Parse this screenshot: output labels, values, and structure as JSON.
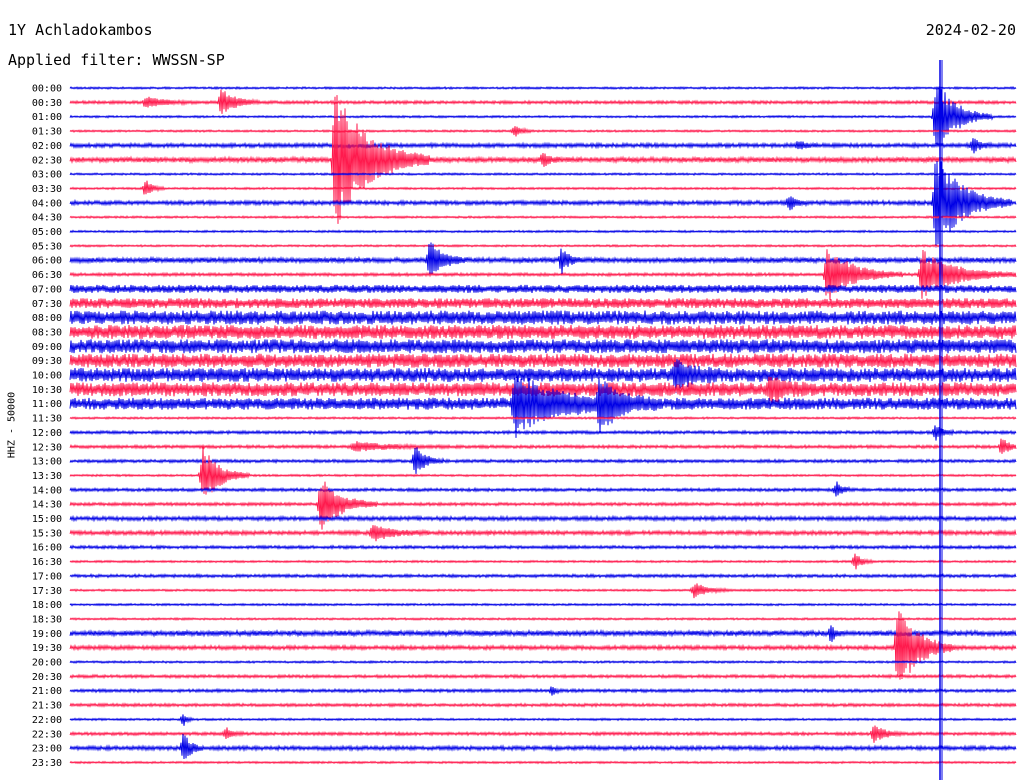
{
  "header": {
    "station": "1Y Achladokambos",
    "date": "2024-02-20",
    "filter": "Applied filter: WWSSN-SP"
  },
  "chart_data": {
    "type": "line",
    "title": "1Y Achladokambos",
    "subtitle": "Applied filter: WWSSN-SP",
    "ylabel": "HHZ - 50000",
    "grid": false,
    "colors": [
      "#0000e6",
      "#ff1a4d"
    ],
    "row_labels": [
      "00:00",
      "00:30",
      "01:00",
      "01:30",
      "02:00",
      "02:30",
      "03:00",
      "03:30",
      "04:00",
      "04:30",
      "05:00",
      "05:30",
      "06:00",
      "06:30",
      "07:00",
      "07:30",
      "08:00",
      "08:30",
      "09:00",
      "09:30",
      "10:00",
      "10:30",
      "11:00",
      "11:30",
      "12:00",
      "12:30",
      "13:00",
      "13:30",
      "14:00",
      "14:30",
      "15:00",
      "15:30",
      "16:00",
      "16:30",
      "17:00",
      "17:30",
      "18:00",
      "18:30",
      "19:00",
      "19:30",
      "20:00",
      "20:30",
      "21:00",
      "21:30",
      "22:00",
      "22:30",
      "23:00",
      "23:30"
    ],
    "noise_level": [
      1,
      1.5,
      1,
      1,
      2,
      2.5,
      1,
      1,
      2,
      1,
      1,
      1,
      2.5,
      1.5,
      4,
      5,
      7,
      7,
      7,
      7,
      7,
      7,
      6,
      1,
      1.5,
      1.5,
      1.5,
      1,
      1.5,
      1.5,
      2,
      2,
      1.5,
      1,
      1.5,
      1,
      1,
      1,
      2.5,
      2,
      1,
      1.5,
      1.5,
      1.5,
      1,
      1.5,
      2,
      1
    ],
    "events": [
      {
        "row": 1,
        "x": 0.08,
        "amp": 6,
        "dur": 0.05
      },
      {
        "row": 1,
        "x": 0.16,
        "amp": 14,
        "dur": 0.04
      },
      {
        "row": 2,
        "x": 0.915,
        "amp": 40,
        "dur": 0.06
      },
      {
        "row": 3,
        "x": 0.47,
        "amp": 6,
        "dur": 0.02
      },
      {
        "row": 4,
        "x": 0.77,
        "amp": 5,
        "dur": 0.02
      },
      {
        "row": 4,
        "x": 0.955,
        "amp": 8,
        "dur": 0.02
      },
      {
        "row": 5,
        "x": 0.28,
        "amp": 70,
        "dur": 0.1
      },
      {
        "row": 5,
        "x": 0.5,
        "amp": 8,
        "dur": 0.02
      },
      {
        "row": 7,
        "x": 0.08,
        "amp": 10,
        "dur": 0.02
      },
      {
        "row": 8,
        "x": 0.76,
        "amp": 8,
        "dur": 0.02
      },
      {
        "row": 8,
        "x": 0.915,
        "amp": 50,
        "dur": 0.08
      },
      {
        "row": 12,
        "x": 0.38,
        "amp": 20,
        "dur": 0.04
      },
      {
        "row": 12,
        "x": 0.52,
        "amp": 14,
        "dur": 0.02
      },
      {
        "row": 13,
        "x": 0.9,
        "amp": 25,
        "dur": 0.1
      },
      {
        "row": 13,
        "x": 0.8,
        "amp": 28,
        "dur": 0.08
      },
      {
        "row": 20,
        "x": 0.64,
        "amp": 14,
        "dur": 0.05
      },
      {
        "row": 21,
        "x": 0.74,
        "amp": 12,
        "dur": 0.04
      },
      {
        "row": 22,
        "x": 0.47,
        "amp": 30,
        "dur": 0.12
      },
      {
        "row": 22,
        "x": 0.56,
        "amp": 26,
        "dur": 0.06
      },
      {
        "row": 24,
        "x": 0.915,
        "amp": 9,
        "dur": 0.02
      },
      {
        "row": 25,
        "x": 0.3,
        "amp": 5,
        "dur": 0.1
      },
      {
        "row": 25,
        "x": 0.985,
        "amp": 11,
        "dur": 0.02
      },
      {
        "row": 26,
        "x": 0.365,
        "amp": 16,
        "dur": 0.03
      },
      {
        "row": 27,
        "x": 0.14,
        "amp": 30,
        "dur": 0.05
      },
      {
        "row": 28,
        "x": 0.81,
        "amp": 8,
        "dur": 0.02
      },
      {
        "row": 29,
        "x": 0.265,
        "amp": 28,
        "dur": 0.06
      },
      {
        "row": 31,
        "x": 0.32,
        "amp": 8,
        "dur": 0.06
      },
      {
        "row": 33,
        "x": 0.83,
        "amp": 9,
        "dur": 0.02
      },
      {
        "row": 35,
        "x": 0.66,
        "amp": 8,
        "dur": 0.04
      },
      {
        "row": 38,
        "x": 0.805,
        "amp": 10,
        "dur": 0.01
      },
      {
        "row": 39,
        "x": 0.875,
        "amp": 45,
        "dur": 0.06
      },
      {
        "row": 42,
        "x": 0.51,
        "amp": 5,
        "dur": 0.01
      },
      {
        "row": 44,
        "x": 0.12,
        "amp": 7,
        "dur": 0.01
      },
      {
        "row": 45,
        "x": 0.165,
        "amp": 6,
        "dur": 0.02
      },
      {
        "row": 45,
        "x": 0.85,
        "amp": 10,
        "dur": 0.03
      },
      {
        "row": 46,
        "x": 0.12,
        "amp": 16,
        "dur": 0.02
      }
    ]
  }
}
